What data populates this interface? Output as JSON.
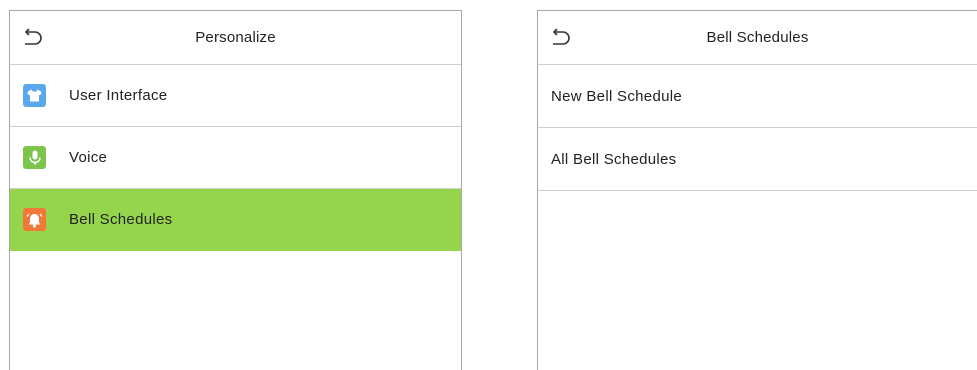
{
  "left_screen": {
    "title": "Personalize",
    "back_icon": "back-arrow-icon",
    "items": [
      {
        "label": "User Interface",
        "icon": "shirt-icon",
        "icon_color": "#5aa8ec",
        "selected": false
      },
      {
        "label": "Voice",
        "icon": "microphone-icon",
        "icon_color": "#7dc44a",
        "selected": false
      },
      {
        "label": "Bell Schedules",
        "icon": "bell-icon",
        "icon_color": "#f2783a",
        "selected": true
      }
    ]
  },
  "right_screen": {
    "title": "Bell Schedules",
    "back_icon": "back-arrow-icon",
    "items": [
      {
        "label": "New Bell Schedule"
      },
      {
        "label": "All Bell Schedules"
      }
    ]
  },
  "colors": {
    "selected_row": "#95d54c",
    "border": "#a9a9a9",
    "divider": "#cfcfcf"
  }
}
